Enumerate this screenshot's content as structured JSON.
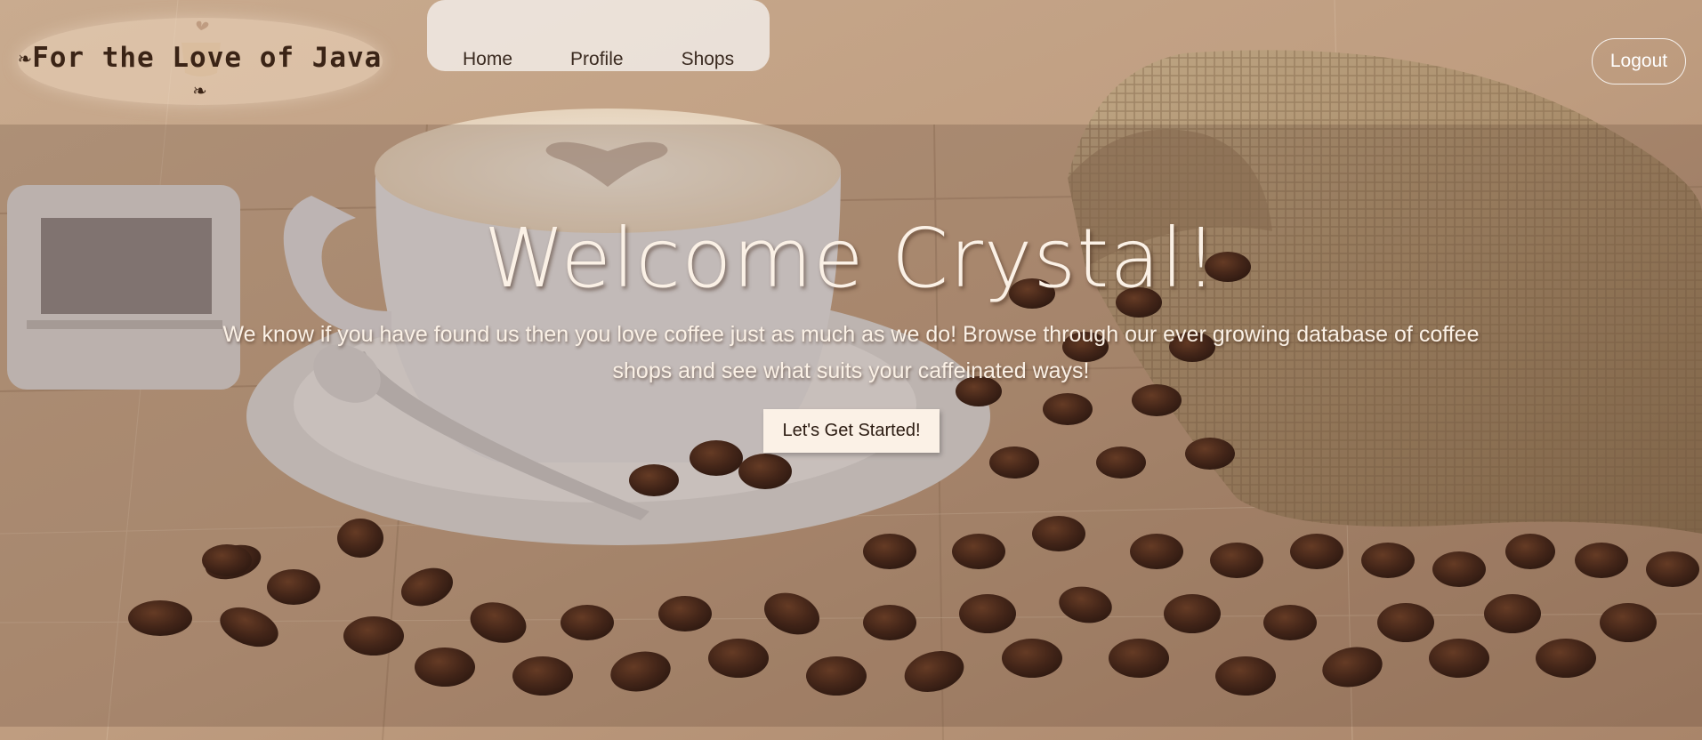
{
  "brand": {
    "name": "For the Love of Java",
    "leaf_left": "❧",
    "leaf_right": "❧"
  },
  "nav": {
    "items": [
      {
        "label": "Home"
      },
      {
        "label": "Profile"
      },
      {
        "label": "Shops"
      }
    ],
    "logout_label": "Logout"
  },
  "hero": {
    "title": "Welcome Crystal!",
    "subtitle": "We know if you have found us then you love coffee just as much as we do! Browse through our ever growing database of coffee shops and see what suits your caffeinated ways!",
    "cta_label": "Let's Get Started!"
  },
  "colors": {
    "text_light": "#fbf1e6",
    "text_dark": "#3b2416",
    "brand_bg": "#ecd6be"
  }
}
